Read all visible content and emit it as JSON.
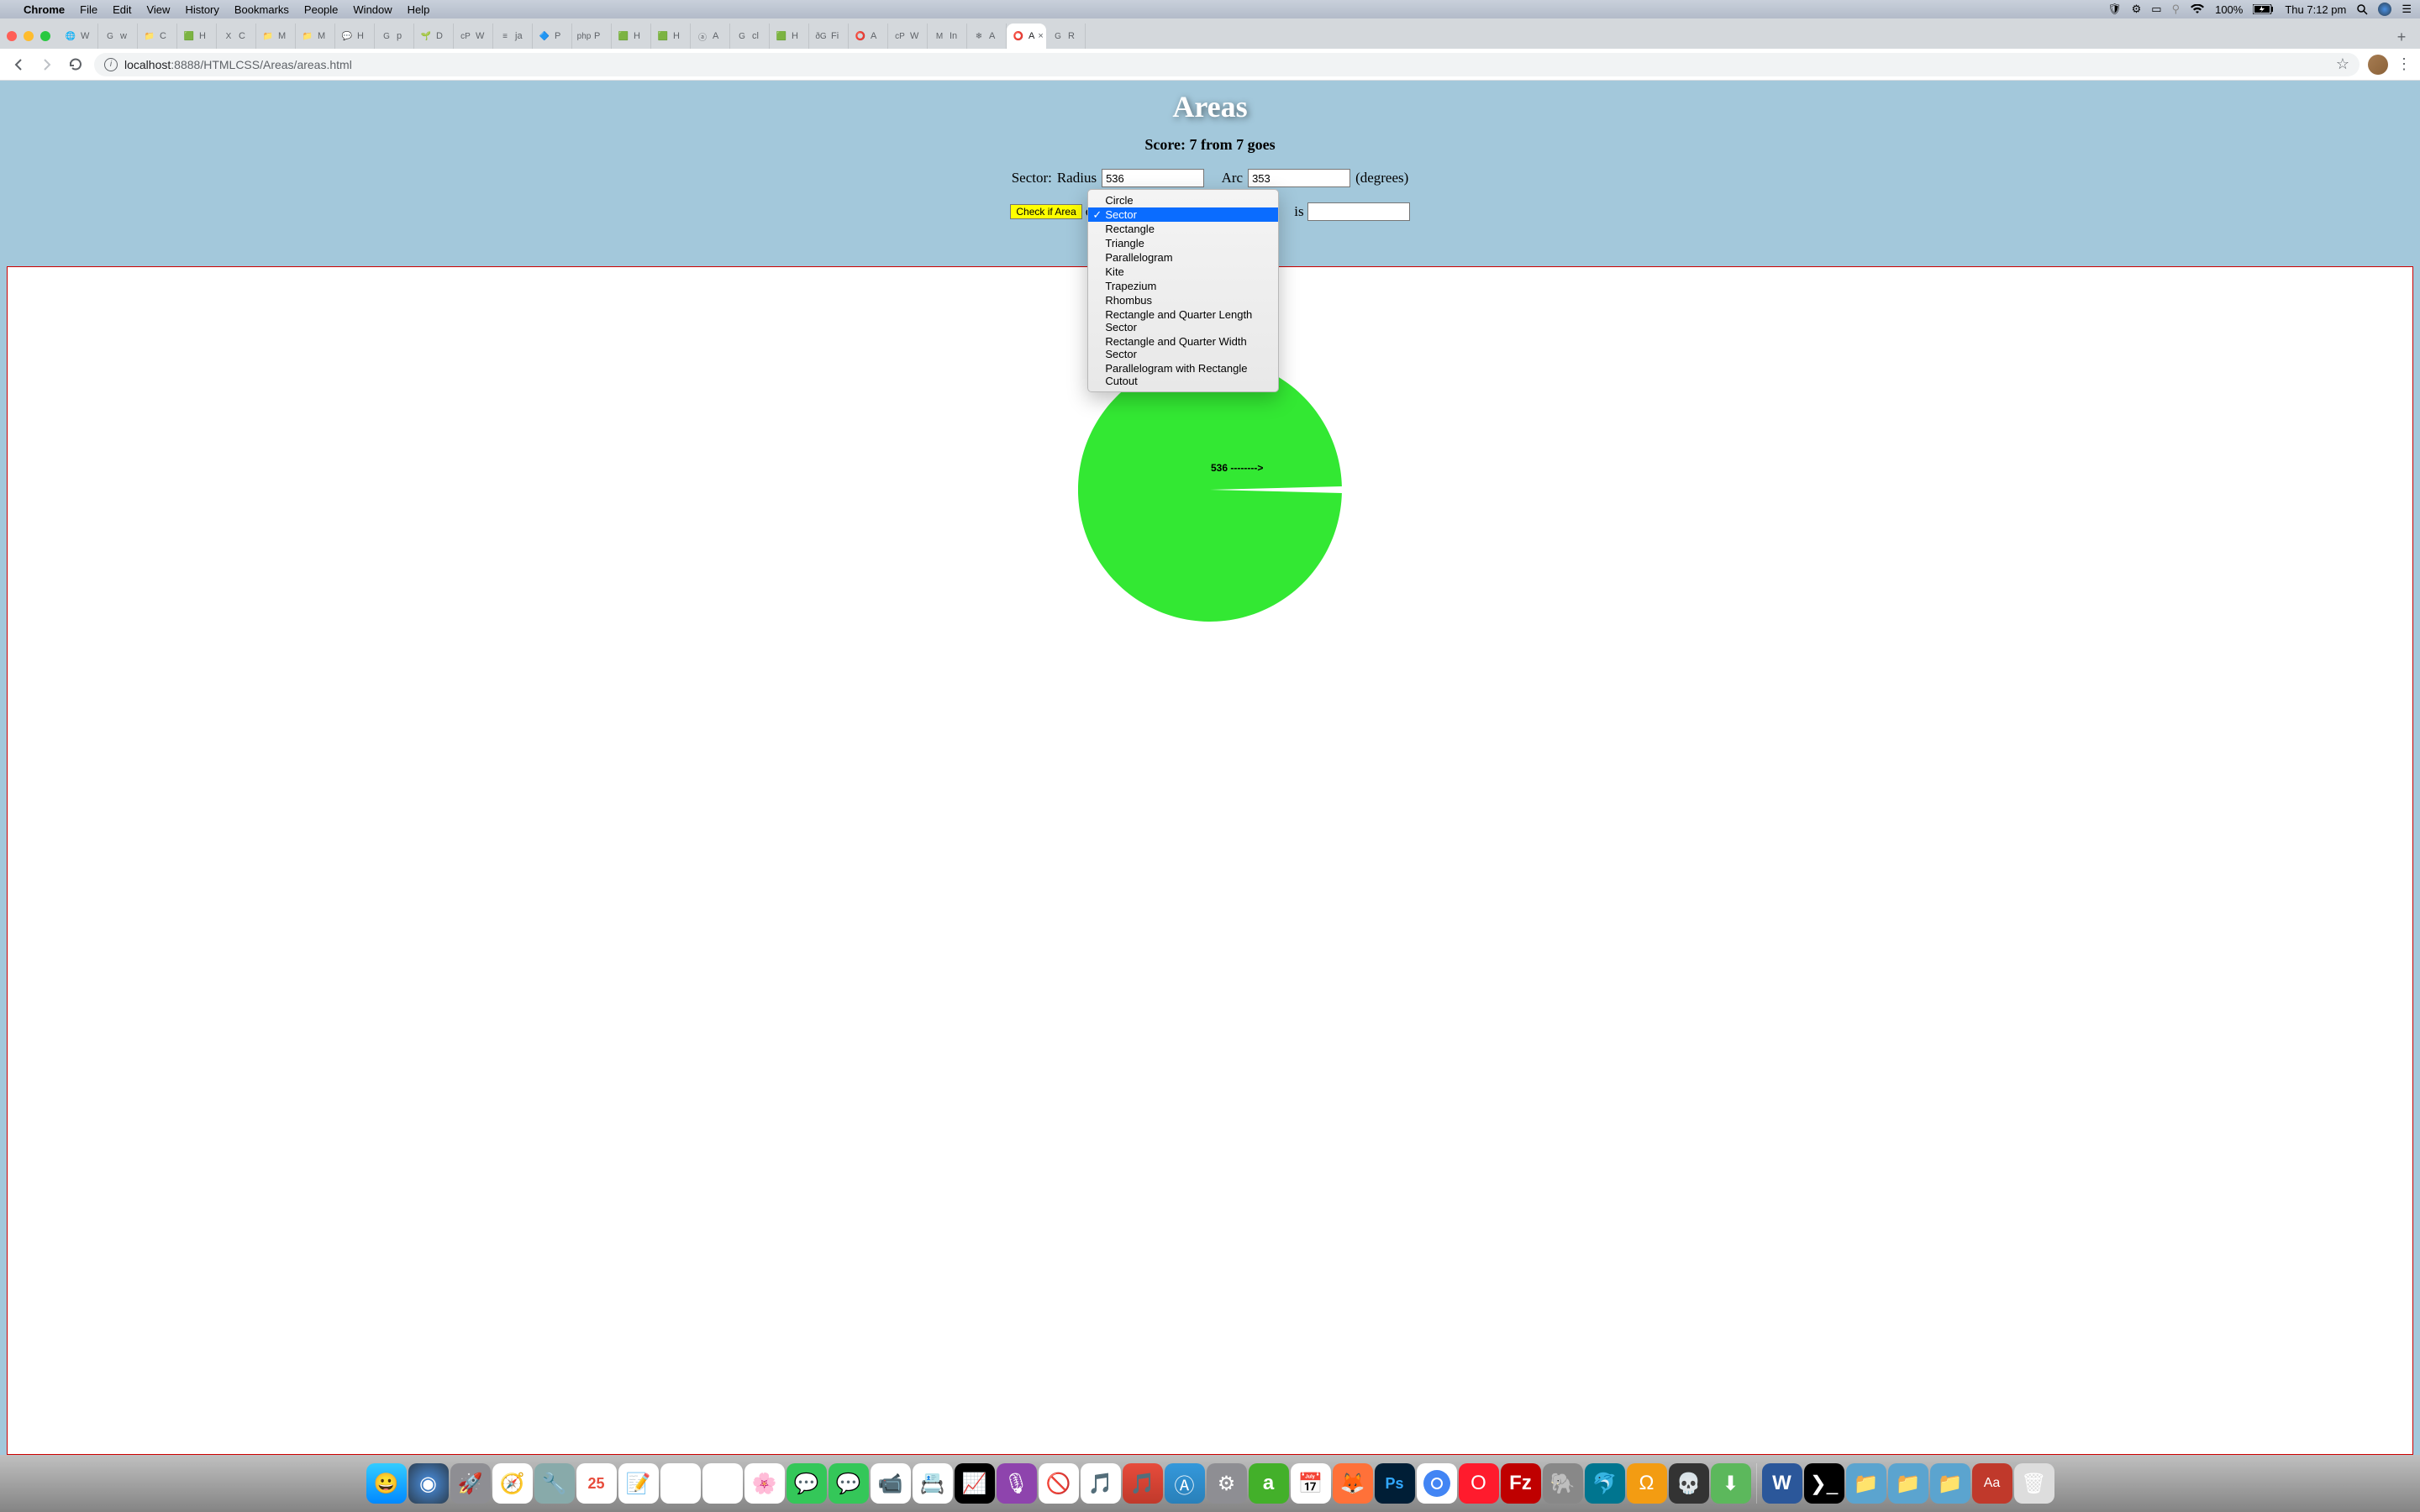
{
  "menubar": {
    "app": "Chrome",
    "items": [
      "File",
      "Edit",
      "View",
      "History",
      "Bookmarks",
      "People",
      "Window",
      "Help"
    ],
    "battery": "100%",
    "clock": "Thu 7:12 pm"
  },
  "browser": {
    "url_host": "localhost",
    "url_port": ":8888",
    "url_path": "/HTMLCSS/Areas/areas.html",
    "tabs": [
      {
        "label": "W",
        "fav": "🌐"
      },
      {
        "label": "w",
        "fav": "G"
      },
      {
        "label": "C",
        "fav": "📁"
      },
      {
        "label": "H",
        "fav": "🟩"
      },
      {
        "label": "C",
        "fav": "X"
      },
      {
        "label": "M",
        "fav": "📁"
      },
      {
        "label": "M",
        "fav": "📁"
      },
      {
        "label": "H",
        "fav": "💬"
      },
      {
        "label": "p",
        "fav": "G"
      },
      {
        "label": "D",
        "fav": "🌱"
      },
      {
        "label": "W",
        "fav": "cP"
      },
      {
        "label": "ja",
        "fav": "≡"
      },
      {
        "label": "P",
        "fav": "🔷"
      },
      {
        "label": "P",
        "fav": "php"
      },
      {
        "label": "H",
        "fav": "🟩"
      },
      {
        "label": "H",
        "fav": "🟩"
      },
      {
        "label": "A",
        "fav": "ⓐ"
      },
      {
        "label": "cl",
        "fav": "G"
      },
      {
        "label": "H",
        "fav": "🟩"
      },
      {
        "label": "Fi",
        "fav": "ðG"
      },
      {
        "label": "A",
        "fav": "⭕"
      },
      {
        "label": "W",
        "fav": "cP"
      },
      {
        "label": "In",
        "fav": "M"
      },
      {
        "label": "A",
        "fav": "❄"
      },
      {
        "label": "A",
        "fav": "⭕",
        "active": true
      },
      {
        "label": "R",
        "fav": "G"
      }
    ]
  },
  "page": {
    "title": "Areas",
    "score_label": "Score: 7 from 7 goes",
    "shape_label": "Sector:",
    "radius_label": "Radius",
    "radius_value": "536",
    "arc_label": "Arc",
    "arc_value": "353",
    "degrees_label": "(degrees)",
    "check_button": "Check if Area",
    "of": "o",
    "is_label": "is",
    "answer_value": "",
    "canvas_radius_label": "536 -------->"
  },
  "dropdown": {
    "options": [
      "Circle",
      "Sector",
      "Rectangle",
      "Triangle",
      "Parallelogram",
      "Kite",
      "Trapezium",
      "Rhombus",
      "Rectangle and Quarter Length Sector",
      "Rectangle and Quarter Width Sector",
      "Parallelogram with Rectangle Cutout"
    ],
    "selected_index": 1
  },
  "chart_data": {
    "type": "pie",
    "title": "Sector",
    "radius": 536,
    "arc_degrees": 353,
    "slices": [
      {
        "name": "sector",
        "degrees": 353,
        "color": "#33e833"
      },
      {
        "name": "gap",
        "degrees": 7,
        "color": "#ffffff"
      }
    ]
  },
  "dock": {
    "icons": [
      "finder",
      "siri",
      "launchpad",
      "safari",
      "tool",
      "calendar",
      "notes",
      "reminders",
      "maps",
      "photos",
      "messages",
      "messages2",
      "facetime",
      "contacts",
      "stocks",
      "podcasts",
      "nosign",
      "music",
      "itunes",
      "appstore",
      "systemprefs",
      "anaconda",
      "cal",
      "firefox",
      "ps",
      "chrome",
      "opera",
      "filezilla",
      "mamp",
      "mysql",
      "audio",
      "skull",
      "torrent",
      "sep",
      "word",
      "terminal",
      "folder1",
      "folder2",
      "folder3",
      "dict",
      "trash"
    ]
  }
}
